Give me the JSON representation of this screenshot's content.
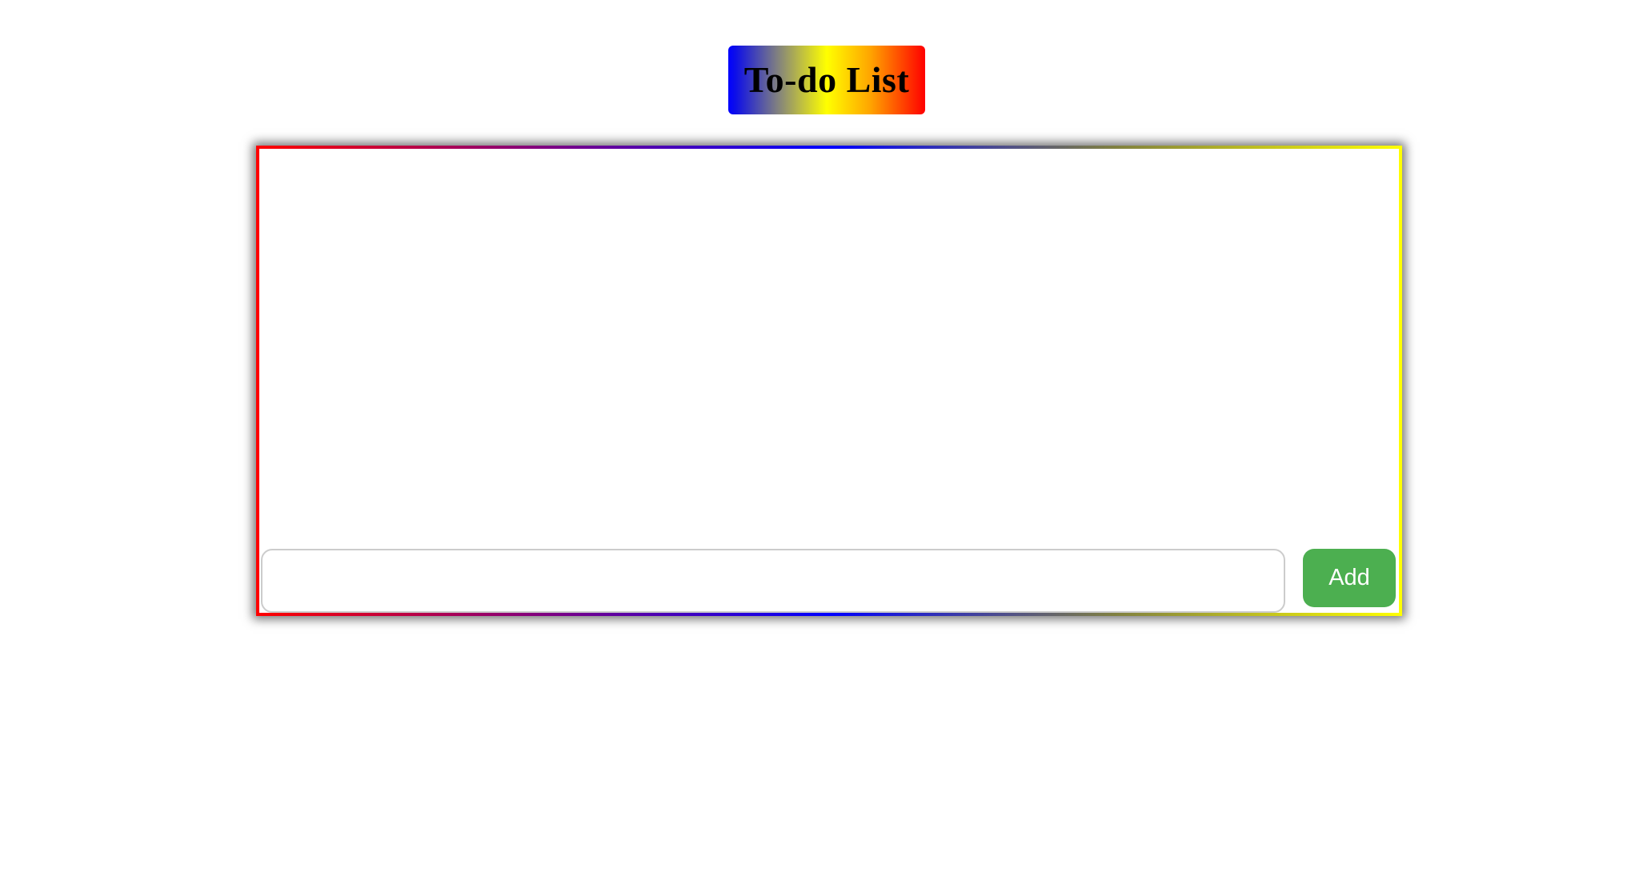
{
  "header": {
    "title": "To-do List"
  },
  "todo": {
    "items": [],
    "input": {
      "value": "",
      "placeholder": ""
    },
    "add_label": "Add"
  },
  "colors": {
    "title_gradient": [
      "#0000ff",
      "#808080",
      "#ffff00",
      "#ffa500",
      "#ff0000"
    ],
    "frame_gradient": [
      "#ff0000",
      "#800080",
      "#0000ff",
      "#808040",
      "#ffff00"
    ],
    "add_button": "#4caf50",
    "add_button_text": "#ffffff"
  }
}
